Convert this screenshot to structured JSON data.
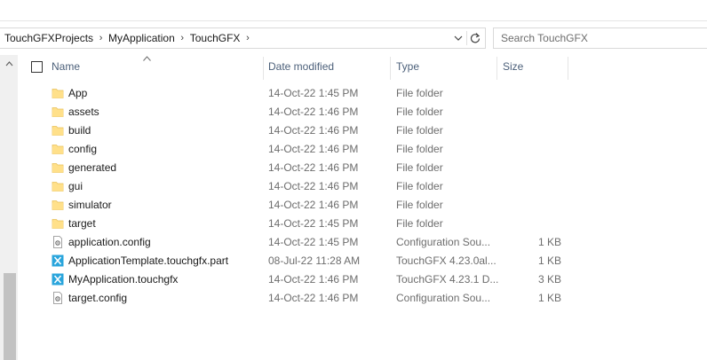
{
  "breadcrumb": [
    "TouchGFXProjects",
    "MyApplication",
    "TouchGFX"
  ],
  "breadcrumb_separator": "›",
  "search": {
    "placeholder": "Search TouchGFX"
  },
  "columns": {
    "name": "Name",
    "date": "Date modified",
    "type": "Type",
    "size": "Size"
  },
  "sort": {
    "column": "Name",
    "direction": "ascending"
  },
  "colors": {
    "folder": "#ffe08a",
    "folder_dark": "#e9c15b",
    "touchgfx": "#2aa5dc",
    "header_text": "#4c607a",
    "meta_text": "#6d6d6d"
  },
  "files": [
    {
      "name": "App",
      "date": "14-Oct-22 1:45 PM",
      "type": "File folder",
      "size": "",
      "icon": "folder-icon"
    },
    {
      "name": "assets",
      "date": "14-Oct-22 1:46 PM",
      "type": "File folder",
      "size": "",
      "icon": "folder-icon"
    },
    {
      "name": "build",
      "date": "14-Oct-22 1:46 PM",
      "type": "File folder",
      "size": "",
      "icon": "folder-icon"
    },
    {
      "name": "config",
      "date": "14-Oct-22 1:46 PM",
      "type": "File folder",
      "size": "",
      "icon": "folder-icon"
    },
    {
      "name": "generated",
      "date": "14-Oct-22 1:46 PM",
      "type": "File folder",
      "size": "",
      "icon": "folder-icon"
    },
    {
      "name": "gui",
      "date": "14-Oct-22 1:46 PM",
      "type": "File folder",
      "size": "",
      "icon": "folder-icon"
    },
    {
      "name": "simulator",
      "date": "14-Oct-22 1:46 PM",
      "type": "File folder",
      "size": "",
      "icon": "folder-icon"
    },
    {
      "name": "target",
      "date": "14-Oct-22 1:45 PM",
      "type": "File folder",
      "size": "",
      "icon": "folder-icon"
    },
    {
      "name": "application.config",
      "date": "14-Oct-22 1:45 PM",
      "type": "Configuration Sou...",
      "size": "1 KB",
      "icon": "config-file-icon"
    },
    {
      "name": "ApplicationTemplate.touchgfx.part",
      "date": "08-Jul-22 11:28 AM",
      "type": "TouchGFX 4.23.0al...",
      "size": "1 KB",
      "icon": "touchgfx-file-icon"
    },
    {
      "name": "MyApplication.touchgfx",
      "date": "14-Oct-22 1:46 PM",
      "type": "TouchGFX 4.23.1 D...",
      "size": "3 KB",
      "icon": "touchgfx-file-icon"
    },
    {
      "name": "target.config",
      "date": "14-Oct-22 1:46 PM",
      "type": "Configuration Sou...",
      "size": "1 KB",
      "icon": "config-file-icon"
    }
  ]
}
